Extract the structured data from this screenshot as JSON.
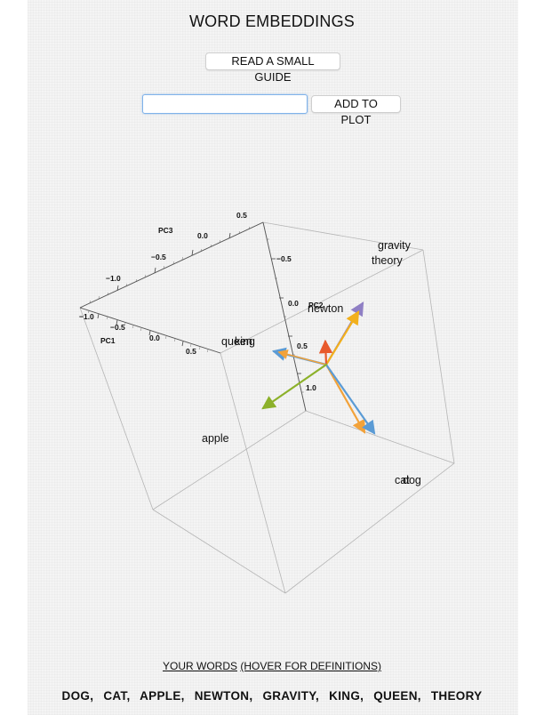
{
  "header": {
    "title": "WORD EMBEDDINGS"
  },
  "guide_button": {
    "label": "READ A SMALL GUIDE"
  },
  "add_form": {
    "input_value": "",
    "add_label": "ADD TO PLOT"
  },
  "plot": {
    "axes": {
      "pc1": {
        "label": "PC1",
        "ticks": [
          "−1.0",
          "−0.5",
          "0.0",
          "0.5"
        ]
      },
      "pc2": {
        "label": "PC2",
        "ticks": [
          "−0.5",
          "0.0",
          "0.5",
          "1.0"
        ]
      },
      "pc3": {
        "label": "PC3",
        "ticks": [
          "−1.0",
          "−0.5",
          "0.0",
          "0.5"
        ]
      }
    },
    "word_labels": [
      "gravity",
      "theory",
      "newton",
      "queen",
      "king",
      "apple",
      "cat",
      "dog"
    ],
    "arrows": [
      {
        "color": "#8f7fc4",
        "name": "purple-arrow"
      },
      {
        "color": "#f2b01c",
        "name": "orange-arrow"
      },
      {
        "color": "#e85a2c",
        "name": "red-arrow"
      },
      {
        "color": "#5b9bd5",
        "name": "blue-arrow"
      },
      {
        "color": "#f2a23a",
        "name": "amber-arrow"
      },
      {
        "color": "#8cb12a",
        "name": "green-arrow"
      }
    ]
  },
  "footer": {
    "your_words": "YOUR WORDS",
    "hover_hint": "(HOVER FOR DEFINITIONS)",
    "words": [
      "DOG",
      "CAT",
      "APPLE",
      "NEWTON",
      "GRAVITY",
      "KING",
      "QUEEN",
      "THEORY"
    ]
  }
}
